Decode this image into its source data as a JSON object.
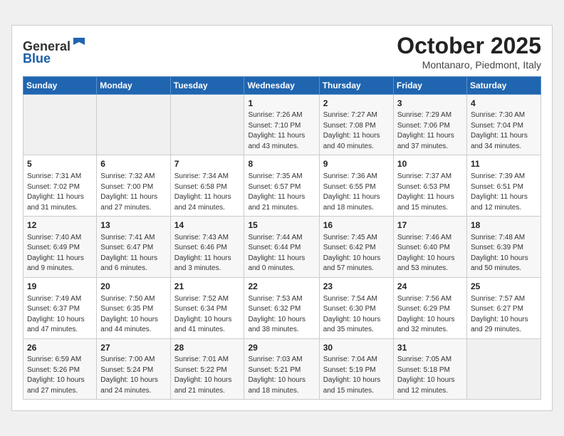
{
  "header": {
    "logo_line1": "General",
    "logo_line2": "Blue",
    "month": "October 2025",
    "location": "Montanaro, Piedmont, Italy"
  },
  "weekdays": [
    "Sunday",
    "Monday",
    "Tuesday",
    "Wednesday",
    "Thursday",
    "Friday",
    "Saturday"
  ],
  "weeks": [
    [
      {
        "day": "",
        "info": ""
      },
      {
        "day": "",
        "info": ""
      },
      {
        "day": "",
        "info": ""
      },
      {
        "day": "1",
        "info": "Sunrise: 7:26 AM\nSunset: 7:10 PM\nDaylight: 11 hours\nand 43 minutes."
      },
      {
        "day": "2",
        "info": "Sunrise: 7:27 AM\nSunset: 7:08 PM\nDaylight: 11 hours\nand 40 minutes."
      },
      {
        "day": "3",
        "info": "Sunrise: 7:29 AM\nSunset: 7:06 PM\nDaylight: 11 hours\nand 37 minutes."
      },
      {
        "day": "4",
        "info": "Sunrise: 7:30 AM\nSunset: 7:04 PM\nDaylight: 11 hours\nand 34 minutes."
      }
    ],
    [
      {
        "day": "5",
        "info": "Sunrise: 7:31 AM\nSunset: 7:02 PM\nDaylight: 11 hours\nand 31 minutes."
      },
      {
        "day": "6",
        "info": "Sunrise: 7:32 AM\nSunset: 7:00 PM\nDaylight: 11 hours\nand 27 minutes."
      },
      {
        "day": "7",
        "info": "Sunrise: 7:34 AM\nSunset: 6:58 PM\nDaylight: 11 hours\nand 24 minutes."
      },
      {
        "day": "8",
        "info": "Sunrise: 7:35 AM\nSunset: 6:57 PM\nDaylight: 11 hours\nand 21 minutes."
      },
      {
        "day": "9",
        "info": "Sunrise: 7:36 AM\nSunset: 6:55 PM\nDaylight: 11 hours\nand 18 minutes."
      },
      {
        "day": "10",
        "info": "Sunrise: 7:37 AM\nSunset: 6:53 PM\nDaylight: 11 hours\nand 15 minutes."
      },
      {
        "day": "11",
        "info": "Sunrise: 7:39 AM\nSunset: 6:51 PM\nDaylight: 11 hours\nand 12 minutes."
      }
    ],
    [
      {
        "day": "12",
        "info": "Sunrise: 7:40 AM\nSunset: 6:49 PM\nDaylight: 11 hours\nand 9 minutes."
      },
      {
        "day": "13",
        "info": "Sunrise: 7:41 AM\nSunset: 6:47 PM\nDaylight: 11 hours\nand 6 minutes."
      },
      {
        "day": "14",
        "info": "Sunrise: 7:43 AM\nSunset: 6:46 PM\nDaylight: 11 hours\nand 3 minutes."
      },
      {
        "day": "15",
        "info": "Sunrise: 7:44 AM\nSunset: 6:44 PM\nDaylight: 11 hours\nand 0 minutes."
      },
      {
        "day": "16",
        "info": "Sunrise: 7:45 AM\nSunset: 6:42 PM\nDaylight: 10 hours\nand 57 minutes."
      },
      {
        "day": "17",
        "info": "Sunrise: 7:46 AM\nSunset: 6:40 PM\nDaylight: 10 hours\nand 53 minutes."
      },
      {
        "day": "18",
        "info": "Sunrise: 7:48 AM\nSunset: 6:39 PM\nDaylight: 10 hours\nand 50 minutes."
      }
    ],
    [
      {
        "day": "19",
        "info": "Sunrise: 7:49 AM\nSunset: 6:37 PM\nDaylight: 10 hours\nand 47 minutes."
      },
      {
        "day": "20",
        "info": "Sunrise: 7:50 AM\nSunset: 6:35 PM\nDaylight: 10 hours\nand 44 minutes."
      },
      {
        "day": "21",
        "info": "Sunrise: 7:52 AM\nSunset: 6:34 PM\nDaylight: 10 hours\nand 41 minutes."
      },
      {
        "day": "22",
        "info": "Sunrise: 7:53 AM\nSunset: 6:32 PM\nDaylight: 10 hours\nand 38 minutes."
      },
      {
        "day": "23",
        "info": "Sunrise: 7:54 AM\nSunset: 6:30 PM\nDaylight: 10 hours\nand 35 minutes."
      },
      {
        "day": "24",
        "info": "Sunrise: 7:56 AM\nSunset: 6:29 PM\nDaylight: 10 hours\nand 32 minutes."
      },
      {
        "day": "25",
        "info": "Sunrise: 7:57 AM\nSunset: 6:27 PM\nDaylight: 10 hours\nand 29 minutes."
      }
    ],
    [
      {
        "day": "26",
        "info": "Sunrise: 6:59 AM\nSunset: 5:26 PM\nDaylight: 10 hours\nand 27 minutes."
      },
      {
        "day": "27",
        "info": "Sunrise: 7:00 AM\nSunset: 5:24 PM\nDaylight: 10 hours\nand 24 minutes."
      },
      {
        "day": "28",
        "info": "Sunrise: 7:01 AM\nSunset: 5:22 PM\nDaylight: 10 hours\nand 21 minutes."
      },
      {
        "day": "29",
        "info": "Sunrise: 7:03 AM\nSunset: 5:21 PM\nDaylight: 10 hours\nand 18 minutes."
      },
      {
        "day": "30",
        "info": "Sunrise: 7:04 AM\nSunset: 5:19 PM\nDaylight: 10 hours\nand 15 minutes."
      },
      {
        "day": "31",
        "info": "Sunrise: 7:05 AM\nSunset: 5:18 PM\nDaylight: 10 hours\nand 12 minutes."
      },
      {
        "day": "",
        "info": ""
      }
    ]
  ]
}
